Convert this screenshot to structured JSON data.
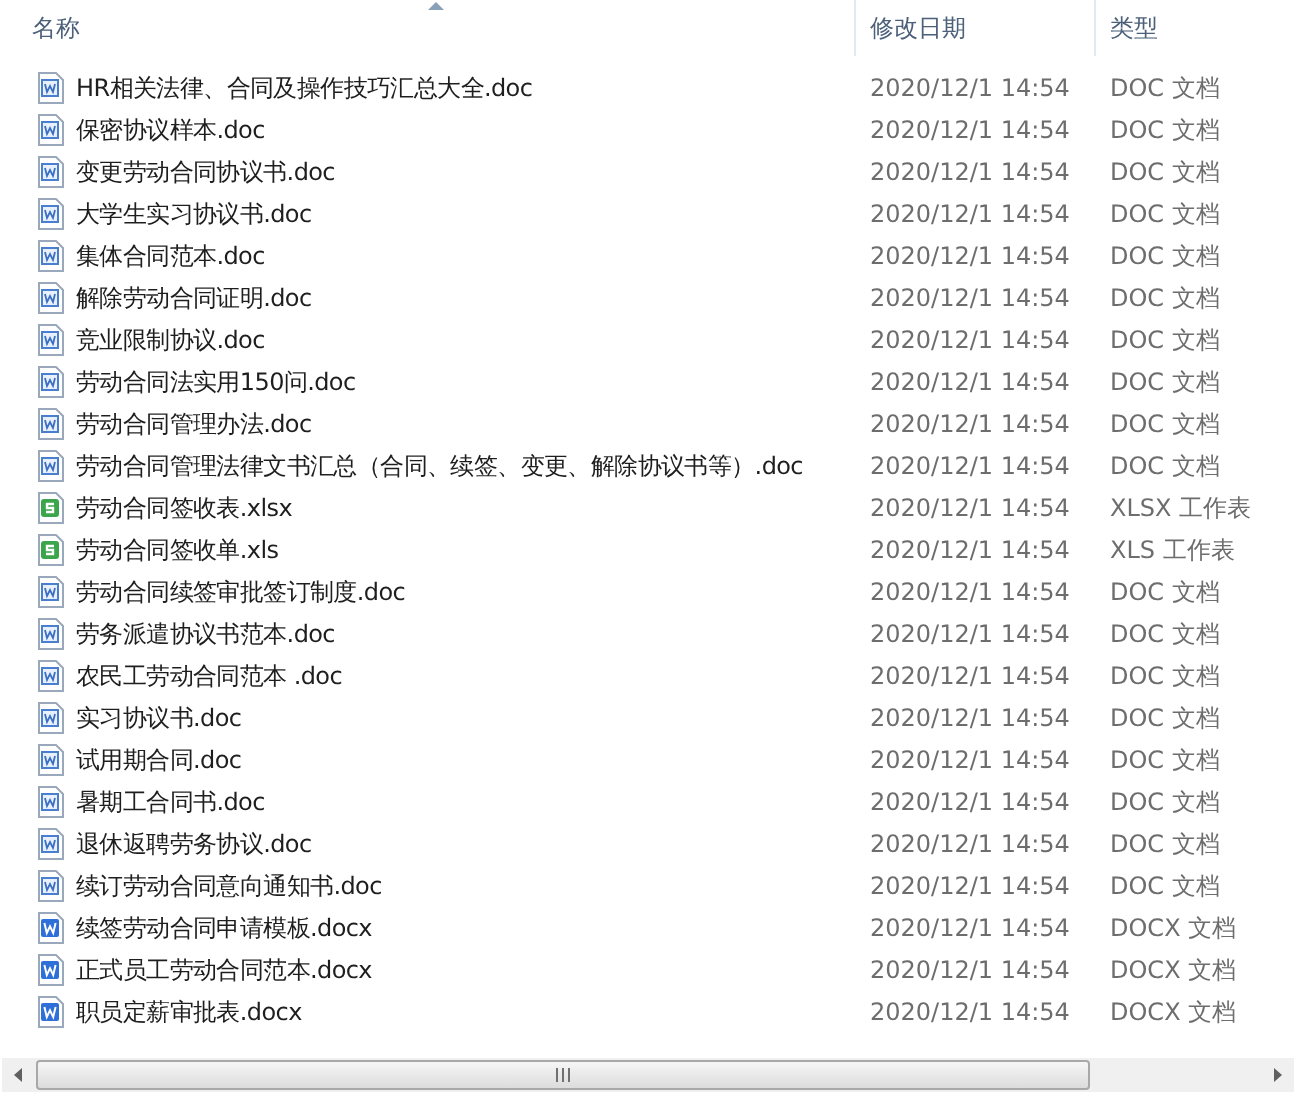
{
  "columns": [
    {
      "label": "名称",
      "sorted": true
    },
    {
      "label": "修改日期",
      "sorted": false
    },
    {
      "label": "类型",
      "sorted": false
    }
  ],
  "files": [
    {
      "name": "HR相关法律、合同及操作技巧汇总大全.doc",
      "modified": "2020/12/1 14:54",
      "type": "DOC 文档",
      "kind": "doc"
    },
    {
      "name": "保密协议样本.doc",
      "modified": "2020/12/1 14:54",
      "type": "DOC 文档",
      "kind": "doc"
    },
    {
      "name": "变更劳动合同协议书.doc",
      "modified": "2020/12/1 14:54",
      "type": "DOC 文档",
      "kind": "doc"
    },
    {
      "name": "大学生实习协议书.doc",
      "modified": "2020/12/1 14:54",
      "type": "DOC 文档",
      "kind": "doc"
    },
    {
      "name": "集体合同范本.doc",
      "modified": "2020/12/1 14:54",
      "type": "DOC 文档",
      "kind": "doc"
    },
    {
      "name": "解除劳动合同证明.doc",
      "modified": "2020/12/1 14:54",
      "type": "DOC 文档",
      "kind": "doc"
    },
    {
      "name": "竞业限制协议.doc",
      "modified": "2020/12/1 14:54",
      "type": "DOC 文档",
      "kind": "doc"
    },
    {
      "name": "劳动合同法实用150问.doc",
      "modified": "2020/12/1 14:54",
      "type": "DOC 文档",
      "kind": "doc"
    },
    {
      "name": "劳动合同管理办法.doc",
      "modified": "2020/12/1 14:54",
      "type": "DOC 文档",
      "kind": "doc"
    },
    {
      "name": "劳动合同管理法律文书汇总（合同、续签、变更、解除协议书等）.doc",
      "modified": "2020/12/1 14:54",
      "type": "DOC 文档",
      "kind": "doc"
    },
    {
      "name": "劳动合同签收表.xlsx",
      "modified": "2020/12/1 14:54",
      "type": "XLSX 工作表",
      "kind": "xls"
    },
    {
      "name": "劳动合同签收单.xls",
      "modified": "2020/12/1 14:54",
      "type": "XLS 工作表",
      "kind": "xls"
    },
    {
      "name": "劳动合同续签审批签订制度.doc",
      "modified": "2020/12/1 14:54",
      "type": "DOC 文档",
      "kind": "doc"
    },
    {
      "name": "劳务派遣协议书范本.doc",
      "modified": "2020/12/1 14:54",
      "type": "DOC 文档",
      "kind": "doc"
    },
    {
      "name": "农民工劳动合同范本 .doc",
      "modified": "2020/12/1 14:54",
      "type": "DOC 文档",
      "kind": "doc"
    },
    {
      "name": "实习协议书.doc",
      "modified": "2020/12/1 14:54",
      "type": "DOC 文档",
      "kind": "doc"
    },
    {
      "name": "试用期合同.doc",
      "modified": "2020/12/1 14:54",
      "type": "DOC 文档",
      "kind": "doc"
    },
    {
      "name": "暑期工合同书.doc",
      "modified": "2020/12/1 14:54",
      "type": "DOC 文档",
      "kind": "doc"
    },
    {
      "name": "退休返聘劳务协议.doc",
      "modified": "2020/12/1 14:54",
      "type": "DOC 文档",
      "kind": "doc"
    },
    {
      "name": "续订劳动合同意向通知书.doc",
      "modified": "2020/12/1 14:54",
      "type": "DOC 文档",
      "kind": "doc"
    },
    {
      "name": "续签劳动合同申请模板.docx",
      "modified": "2020/12/1 14:54",
      "type": "DOCX 文档",
      "kind": "docx"
    },
    {
      "name": "正式员工劳动合同范本.docx",
      "modified": "2020/12/1 14:54",
      "type": "DOCX 文档",
      "kind": "docx"
    },
    {
      "name": "职员定薪审批表.docx",
      "modified": "2020/12/1 14:54",
      "type": "DOCX 文档",
      "kind": "docx"
    }
  ]
}
